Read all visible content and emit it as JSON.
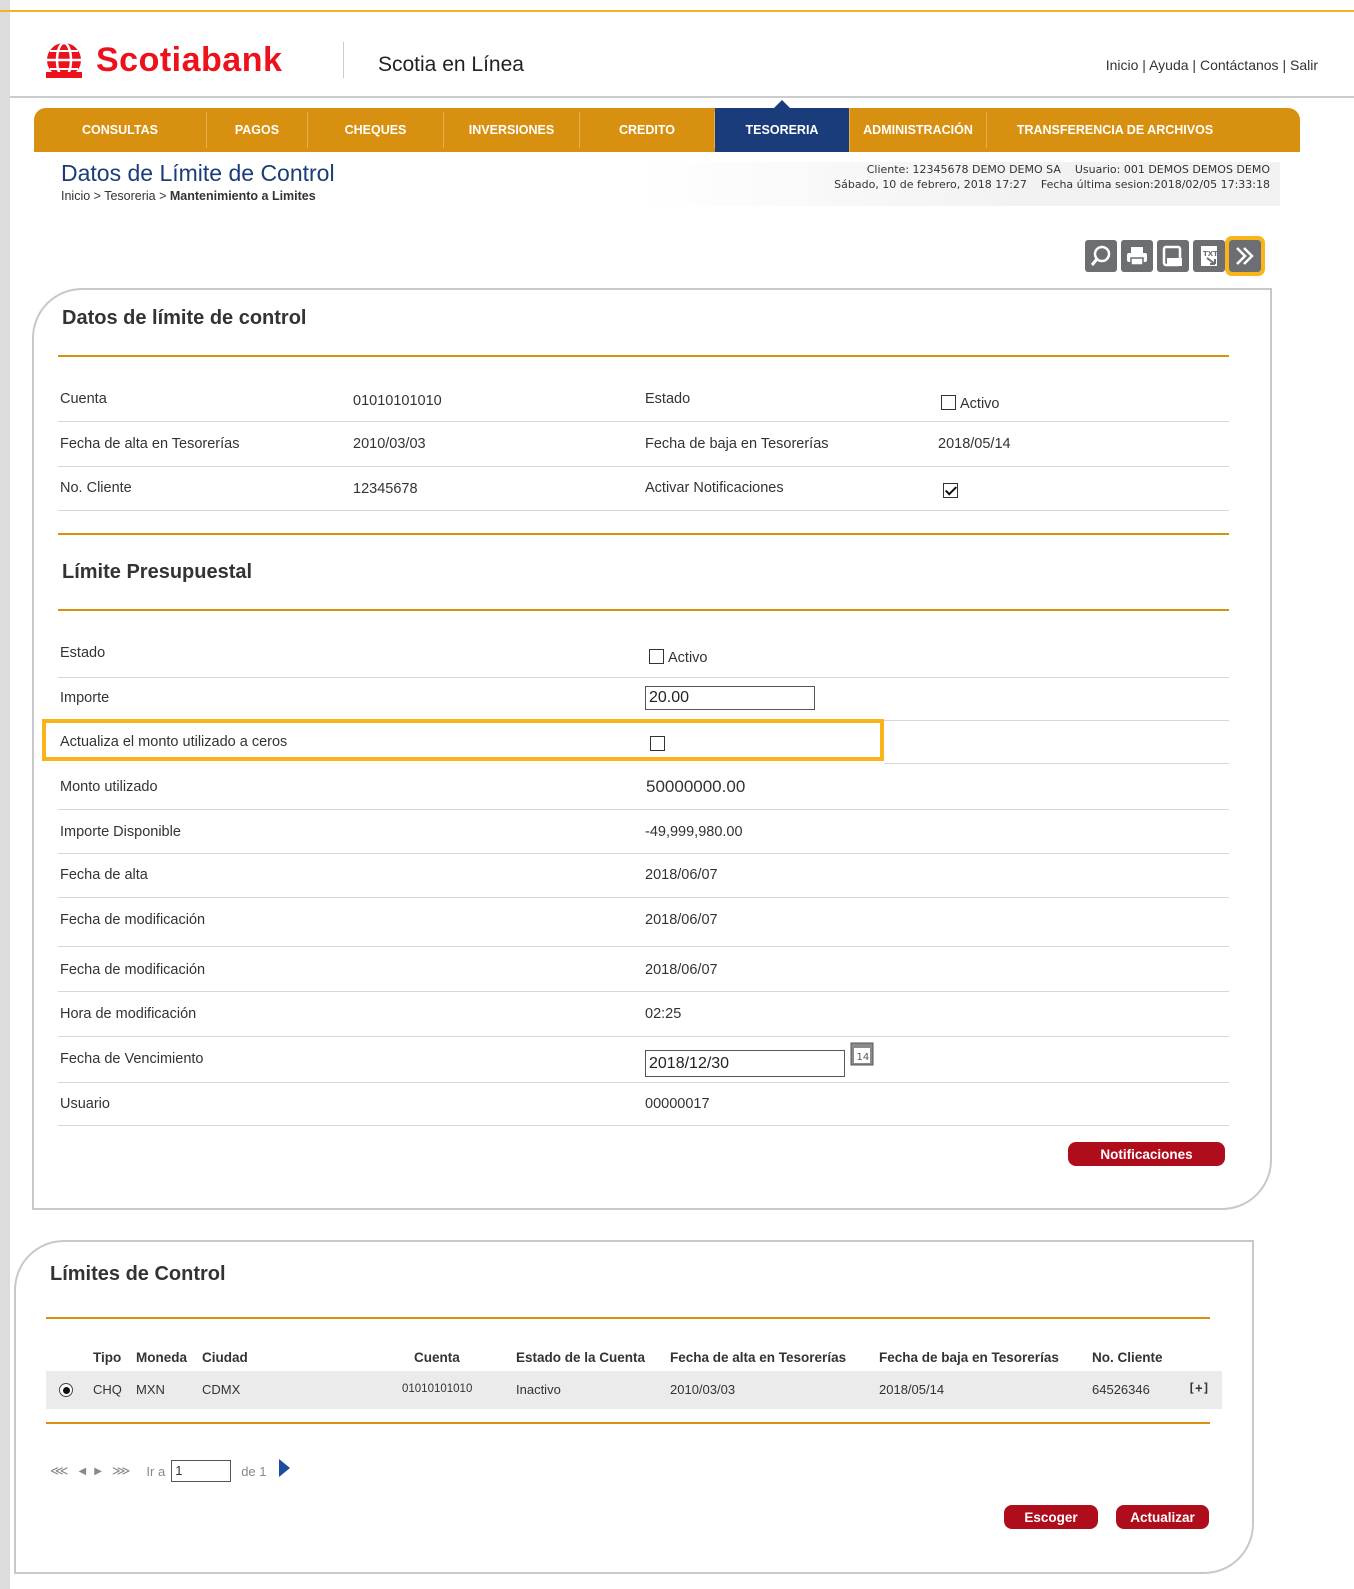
{
  "header": {
    "brand": "Scotiabank",
    "app_name": "Scotia en Línea",
    "links": [
      "Inicio",
      "Ayuda",
      "Contáctanos",
      "Salir"
    ]
  },
  "nav": {
    "items": [
      "CONSULTAS",
      "PAGOS",
      "CHEQUES",
      "INVERSIONES",
      "CREDITO",
      "TESORERIA",
      "ADMINISTRACIÓN",
      "TRANSFERENCIA DE ARCHIVOS"
    ],
    "active": "TESORERIA"
  },
  "page": {
    "title": "Datos de Límite de Control",
    "breadcrumb_prefix": "Inicio > Tesoreria > ",
    "breadcrumb_current": "Mantenimiento a Limites"
  },
  "session": {
    "line1": "Cliente: 12345678 DEMO DEMO SA    Usuario: 001 DEMOS DEMOS DEMO",
    "line2": "Sábado, 10 de febrero, 2018 17:27    Fecha última sesion:2018/02/05 17:33:18"
  },
  "toolbar": {
    "icons": [
      "search-icon",
      "print-icon",
      "save-icon",
      "export-txt-icon",
      "next-icon"
    ]
  },
  "datos": {
    "title": "Datos de límite de control",
    "cuenta_label": "Cuenta",
    "cuenta_value": "01010101010",
    "estado_label": "Estado",
    "estado_cb_label": "Activo",
    "estado_checked": false,
    "fecha_alta_label": "Fecha de alta en Tesorerías",
    "fecha_alta_value": "2010/03/03",
    "fecha_baja_label": "Fecha de baja en Tesorerías",
    "fecha_baja_value": "2018/05/14",
    "no_cliente_label": "No. Cliente",
    "no_cliente_value": "12345678",
    "notif_label": "Activar Notificaciones",
    "notif_checked": true
  },
  "presupuestal": {
    "title": "Límite Presupuestal",
    "estado_label": "Estado",
    "estado_cb_label": "Activo",
    "estado_checked": false,
    "importe_label": "Importe",
    "importe_value": "20.00",
    "actualiza_label": "Actualiza el monto utilizado a ceros",
    "actualiza_checked": false,
    "monto_label": "Monto utilizado",
    "monto_value": "50000000.00",
    "disponible_label": "Importe Disponible",
    "disponible_value": "-49,999,980.00",
    "fecha_alta_label": "Fecha de alta",
    "fecha_alta_value": "2018/06/07",
    "fecha_mod_label": "Fecha de modificación",
    "fecha_mod_value": "2018/06/07",
    "fecha_mod2_label": "Fecha de modificación",
    "fecha_mod2_value": "2018/06/07",
    "hora_mod_label": "Hora de modificación",
    "hora_mod_value": "02:25",
    "vencimiento_label": "Fecha de Vencimiento",
    "vencimiento_value": "2018/12/30",
    "calendar_day": "14",
    "usuario_label": "Usuario",
    "usuario_value": "00000017",
    "notificaciones_button": "Notificaciones"
  },
  "limites": {
    "title": "Límites de Control",
    "columns": [
      "Tipo",
      "Moneda",
      "Ciudad",
      "Cuenta",
      "Estado de la Cuenta",
      "Fecha de alta en Tesorerías",
      "Fecha de baja en Tesorerías",
      "No. Cliente"
    ],
    "row": {
      "tipo": "CHQ",
      "moneda": "MXN",
      "ciudad": "CDMX",
      "cuenta": "01010101010",
      "estado": "Inactivo",
      "fecha_alta": "2010/03/03",
      "fecha_baja": "2018/05/14",
      "no_cliente": "64526346",
      "expand": "[+]"
    },
    "pager": {
      "ir_a": "Ir a",
      "page_value": "1",
      "de": "de 1"
    },
    "escoger_button": "Escoger",
    "actualizar_button": "Actualizar"
  }
}
